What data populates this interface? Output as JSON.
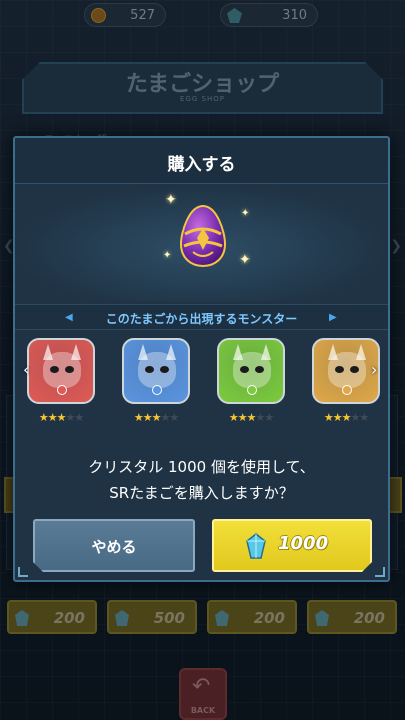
{
  "topbar": {
    "coins": "527",
    "crystals": "310"
  },
  "shop": {
    "title": "たまごショップ",
    "subtitle": "EGG SHOP",
    "tab_label": "モンスター 超S..."
  },
  "background_prices": [
    "200",
    "500",
    "200",
    "200"
  ],
  "back_button": {
    "label": "BACK"
  },
  "modal": {
    "title": "購入する",
    "egg_icon": "purple-gold-egg",
    "section_label": "このたまごから出現するモンスター",
    "monsters": [
      {
        "name": "red-dragon",
        "color": "#e05a55",
        "stars": 3,
        "max_stars": 5
      },
      {
        "name": "blue-dragon",
        "color": "#5b95e0",
        "stars": 3,
        "max_stars": 5
      },
      {
        "name": "green-dragon",
        "color": "#7ccb3e",
        "stars": 3,
        "max_stars": 5
      },
      {
        "name": "yellow-dragon",
        "color": "#e0a848",
        "stars": 3,
        "max_stars": 5
      }
    ],
    "question_line1": "クリスタル 1000 個を使用して、",
    "question_line2": "SRたまごを購入しますか？",
    "cancel_label": "やめる",
    "buy_price": "1000",
    "buy_icon": "crystal-icon"
  },
  "colors": {
    "accent_blue": "#7ec8ff",
    "buy_yellow": "#f2df3a",
    "cancel_blue": "#5a7b95",
    "star": "#f7c531"
  }
}
